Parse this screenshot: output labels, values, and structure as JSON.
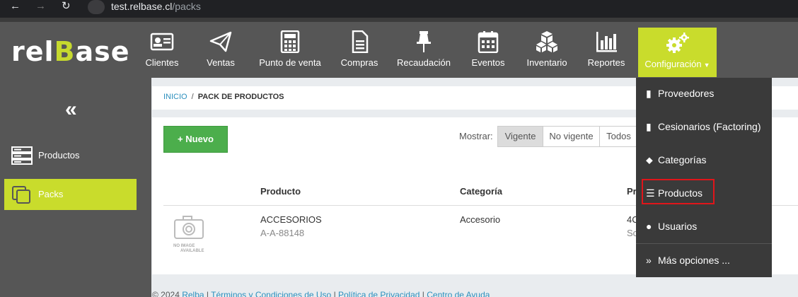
{
  "browser": {
    "url_host": "test.relbase.cl",
    "url_path": "/packs"
  },
  "logo": {
    "part1": "rel",
    "part2": "B",
    "part3": "ase"
  },
  "topnav": [
    {
      "label": "Clientes",
      "icon": "contact-card-icon"
    },
    {
      "label": "Ventas",
      "icon": "paper-plane-icon"
    },
    {
      "label": "Punto de venta",
      "icon": "calculator-icon"
    },
    {
      "label": "Compras",
      "icon": "document-icon"
    },
    {
      "label": "Recaudación",
      "icon": "pushpin-icon"
    },
    {
      "label": "Eventos",
      "icon": "calendar-icon"
    },
    {
      "label": "Inventario",
      "icon": "cubes-icon"
    },
    {
      "label": "Reportes",
      "icon": "bar-chart-icon"
    },
    {
      "label": "Configuración",
      "icon": "gears-icon"
    }
  ],
  "sidebar": {
    "collapse": "«",
    "items": [
      {
        "label": "Productos"
      },
      {
        "label": "Packs"
      }
    ]
  },
  "breadcrumb": {
    "home": "INICIO",
    "sep": "/",
    "current": "PACK DE PRODUCTOS"
  },
  "toolbar": {
    "new_label": "Nuevo",
    "new_plus": "+",
    "show_label": "Mostrar:",
    "filters": [
      "Vigente",
      "No vigente",
      "Todos"
    ],
    "active_filter": "Vigente"
  },
  "table": {
    "headers": [
      "Producto",
      "Categoría",
      "Pr"
    ],
    "rows": [
      {
        "product": "ACCESORIOS",
        "code": "A-A-88148",
        "category": "Accesorio",
        "price": "4C",
        "price_sub": "Sc"
      }
    ],
    "noimage_line1": "NO IMAGE",
    "noimage_line2": "AVAILABLE"
  },
  "footer": {
    "copyright": "© 2024",
    "brand": "Relba",
    "terms": "Términos y Condiciones de Uso",
    "privacy": "Política de Privacidad",
    "help": "Centro de Ayuda"
  },
  "dropdown": [
    {
      "label": "Proveedores",
      "icon": "building-icon"
    },
    {
      "label": "Cesionarios (Factoring)",
      "icon": "building-icon"
    },
    {
      "label": "Categorías",
      "icon": "tags-icon"
    },
    {
      "label": "Productos",
      "icon": "list-icon"
    },
    {
      "label": "Usuarios",
      "icon": "users-icon"
    },
    {
      "label": "Más opciones ...",
      "icon": "double-chevron-right-icon"
    }
  ],
  "colors": {
    "accent": "#c9dc2c",
    "nav_bg": "#565656",
    "success": "#4cae4c",
    "highlight": "#e0151a"
  }
}
